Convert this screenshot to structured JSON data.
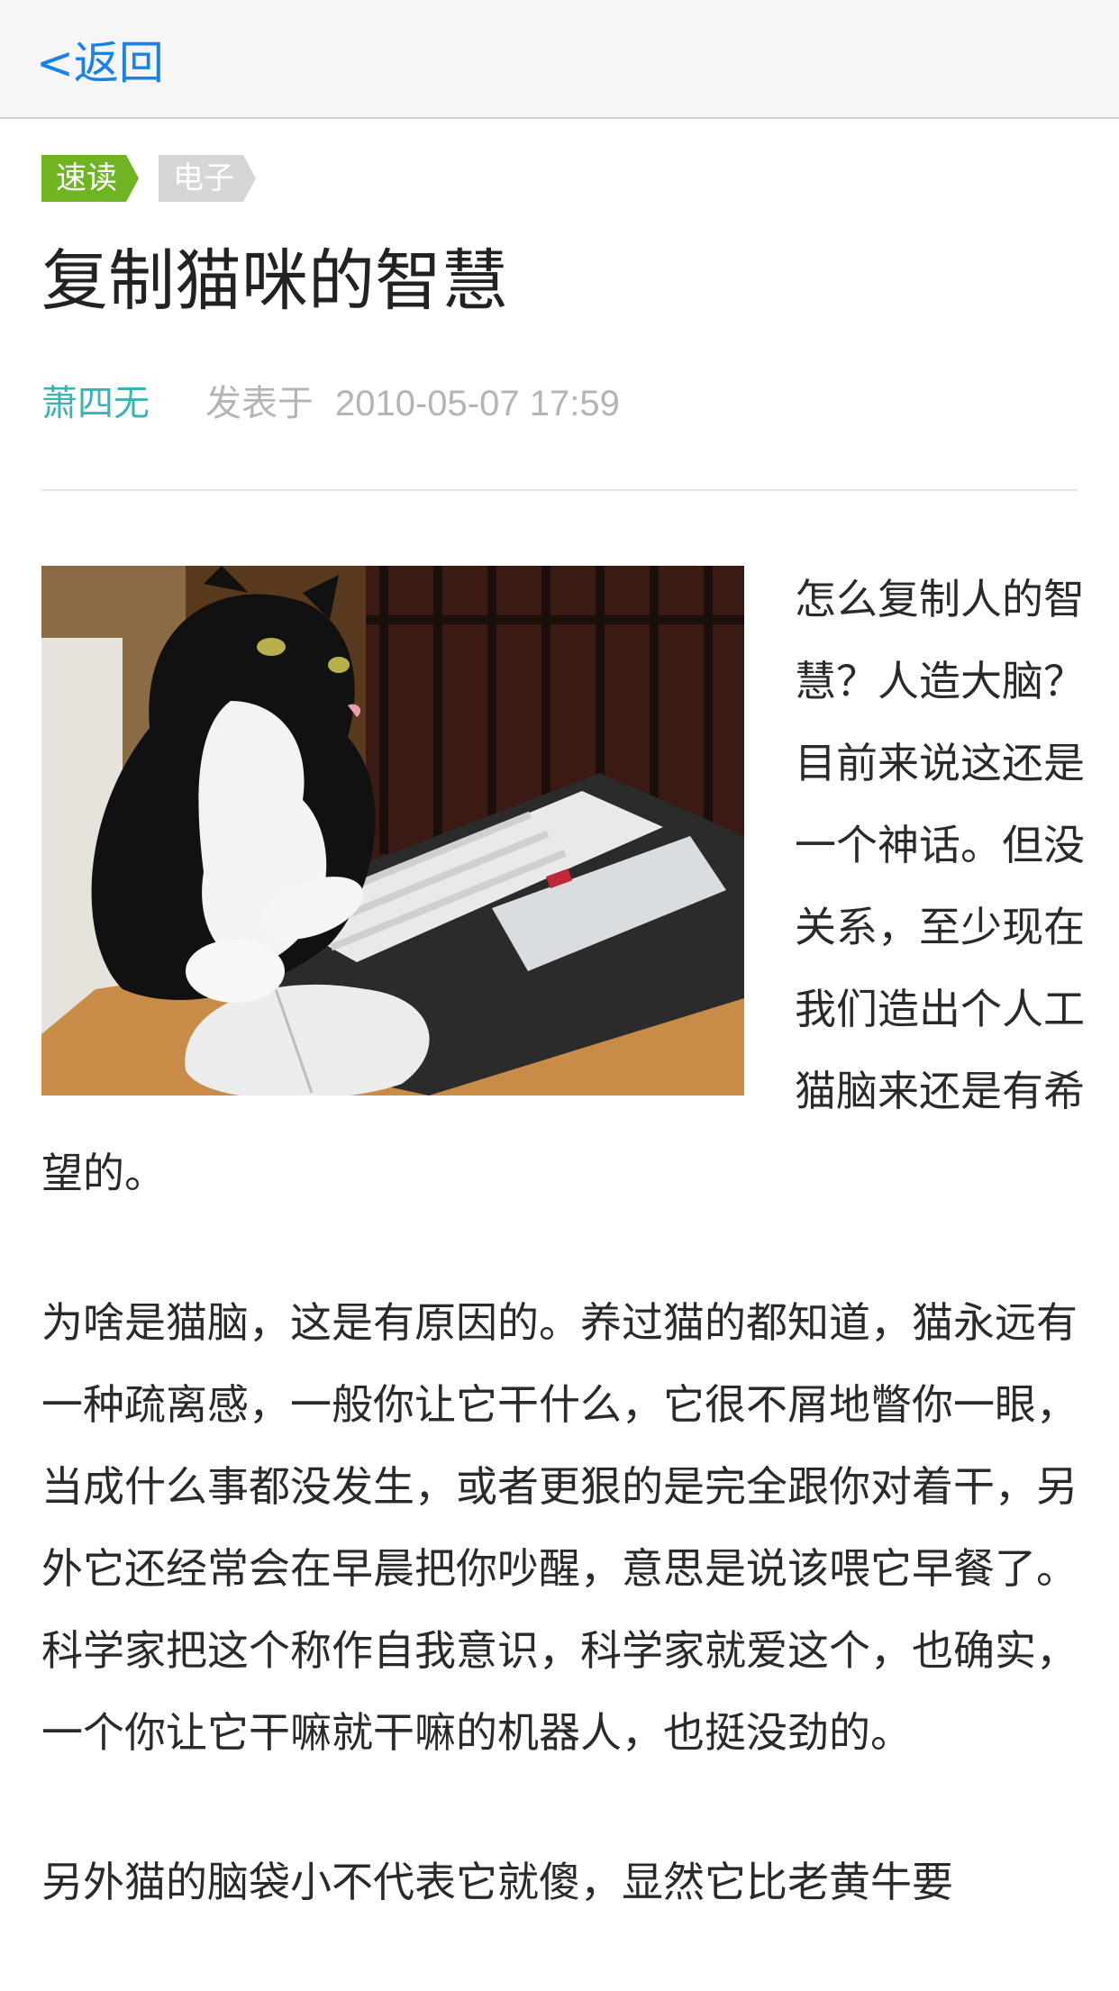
{
  "navbar": {
    "back_label": "<返回"
  },
  "tags": [
    {
      "label": "速读"
    },
    {
      "label": "电子"
    }
  ],
  "article": {
    "title": "复制猫咪的智慧",
    "author": "萧四无",
    "posted_label": "发表于",
    "datetime": "2010-05-07 17:59",
    "image_icon": "cat-at-keyboard-photo",
    "paragraphs": [
      "怎么复制人的智慧？人造大脑？目前来说这还是一个神话。但没关系，至少现在我们造出个人工猫脑来还是有希望的。",
      "为啥是猫脑，这是有原因的。养过猫的都知道，猫永远有一种疏离感，一般你让它干什么，它很不屑地瞥你一眼，当成什么事都没发生，或者更狠的是完全跟你对着干，另外它还经常会在早晨把你吵醒，意思是说该喂它早餐了。科学家把这个称作自我意识，科学家就爱这个，也确实，一个你让它干嘛就干嘛的机器人，也挺没劲的。",
      "另外猫的脑袋小不代表它就傻，显然它比老黄牛要"
    ]
  },
  "colors": {
    "link_blue": "#1a82e6",
    "tag_green": "#6fb523",
    "tag_gray": "#d6d6d6",
    "author_teal": "#3bb3b3",
    "meta_gray": "#b4b4b4"
  }
}
